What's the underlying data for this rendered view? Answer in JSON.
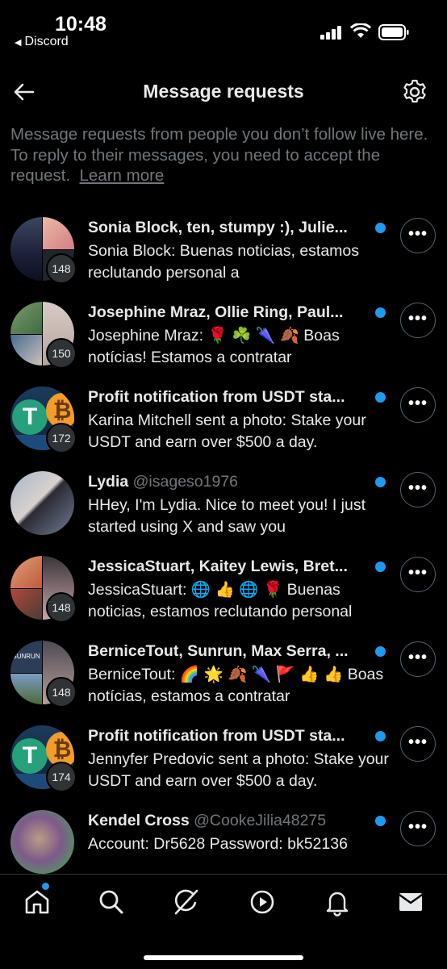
{
  "status": {
    "time": "10:48",
    "back_app": "Discord"
  },
  "header": {
    "title": "Message requests"
  },
  "intro": {
    "text": "Message requests from people you don’t follow live here. To reply to their messages, you need to accept the request.",
    "link": "Learn more"
  },
  "requests": [
    {
      "name": "Sonia Block, ten, stumpy :), Julie...",
      "handle": "",
      "preview": "Sonia Block: Buenas noticias, estamos reclutando personal a",
      "count": "148",
      "unread": true
    },
    {
      "name": "Josephine Mraz, Ollie Ring, Paul...",
      "handle": "",
      "preview": "Josephine Mraz: 🌹 ☘️ 🌂 🍂 Boas notícias! Estamos a contratar",
      "count": "150",
      "unread": true
    },
    {
      "name": "Profit notification from USDT sta...",
      "handle": "",
      "preview": "Karina Mitchell sent a photo: Stake your USDT and earn over $500 a day.",
      "count": "172",
      "unread": true
    },
    {
      "name": "Lydia",
      "handle": "@isageso1976",
      "preview": "HHey, I'm Lydia.  Nice to meet you!  I just started using X and saw you",
      "count": "",
      "unread": true
    },
    {
      "name": "JessicaStuart, Kaitey Lewis, Bret...",
      "handle": "",
      "preview": "JessicaStuart: 🌐 👍 🌐 🌹 Buenas noticias, estamos reclutando personal",
      "count": "148",
      "unread": true
    },
    {
      "name": "BerniceTout, Sunrun, Max Serra, ...",
      "handle": "",
      "preview": "BerniceTout: 🌈 🌟 🍂 🌂 🚩 👍 👍 Boas notícias, estamos a contratar",
      "count": "148",
      "unread": true
    },
    {
      "name": "Profit notification from USDT sta...",
      "handle": "",
      "preview": "Jennyfer Predovic sent a photo: Stake your USDT and earn over $500 a day.",
      "count": "174",
      "unread": true
    },
    {
      "name": "Kendel Cross",
      "handle": "@CookeJilia48275",
      "preview": "Account: Dr5628 Password: bk52136",
      "count": "",
      "unread": true
    }
  ],
  "nav": [
    "home-icon",
    "search-icon",
    "grok-icon",
    "video-icon",
    "notifications-icon",
    "messages-icon"
  ]
}
